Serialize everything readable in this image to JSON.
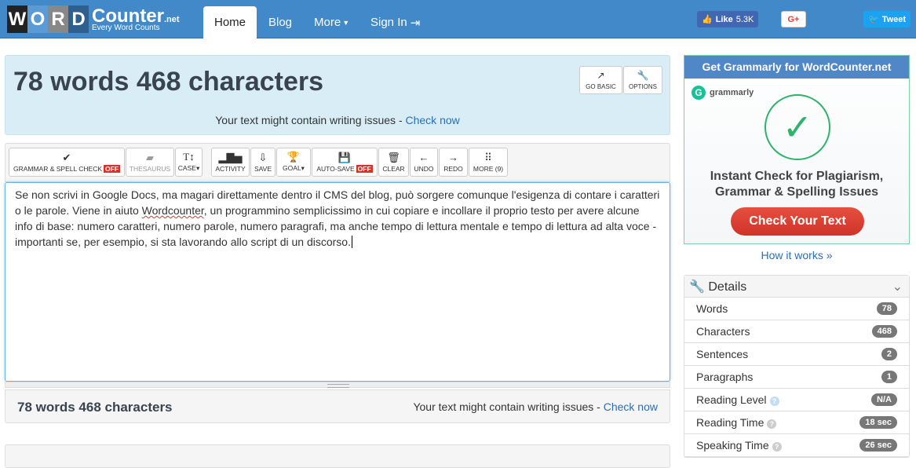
{
  "nav": {
    "logo_letters": [
      "W",
      "O",
      "R",
      "D"
    ],
    "logo_name": "Counter",
    "logo_tld": ".net",
    "logo_tagline": "Every Word Counts",
    "items": [
      "Home",
      "Blog",
      "More",
      "Sign In"
    ],
    "like": "Like",
    "like_count": "5.3K",
    "gplus": "G+",
    "tweet": "Tweet"
  },
  "header": {
    "title": "78 words 468 characters",
    "go_basic": "GO BASIC",
    "options": "OPTIONS",
    "issue_text": "Your text might contain writing issues - ",
    "check_now": "Check now"
  },
  "toolbar": {
    "grammar": "GRAMMAR & SPELL CHECK",
    "off": "OFF",
    "thesaurus": "THESAURUS",
    "case": "CASE",
    "activity": "ACTIVITY",
    "save": "SAVE",
    "goal": "GOAL",
    "autosave": "AUTO-SAVE",
    "clear": "CLEAR",
    "undo": "UNDO",
    "redo": "REDO",
    "more": "MORE (9)"
  },
  "editor": {
    "before": "Se non scrivi in Google Docs, ma magari direttamente dentro il CMS del blog, può sorgere comunque l'esigenza di contare i caratteri o le parole. Viene in aiuto ",
    "misspelled": "Wordcounter",
    "after": ", un programmino semplicissimo in cui copiare e incollare il proprio testo per avere alcune info di base: numero caratteri, numero parole, numero paragrafi, ma anche tempo di lettura mentale e tempo di lettura ad alta voce - importanti se, per esempio, si sta lavorando allo script di un discorso."
  },
  "footer": {
    "title": "78 words 468 characters",
    "issue_text": "Your text might contain writing issues - ",
    "check_now": "Check now"
  },
  "ad": {
    "header": "Get Grammarly for WordCounter.net",
    "brand": "grammarly",
    "headline1": "Instant Check for Plagiarism,",
    "headline2": "Grammar & Spelling Issues",
    "cta": "Check Your Text",
    "how": "How it works »"
  },
  "details": {
    "title": "Details",
    "rows": [
      {
        "label": "Words",
        "value": "78"
      },
      {
        "label": "Characters",
        "value": "468"
      },
      {
        "label": "Sentences",
        "value": "2"
      },
      {
        "label": "Paragraphs",
        "value": "1"
      },
      {
        "label": "Reading Level",
        "value": "N/A"
      },
      {
        "label": "Reading Time",
        "value": "18 sec"
      },
      {
        "label": "Speaking Time",
        "value": "26 sec"
      }
    ]
  }
}
